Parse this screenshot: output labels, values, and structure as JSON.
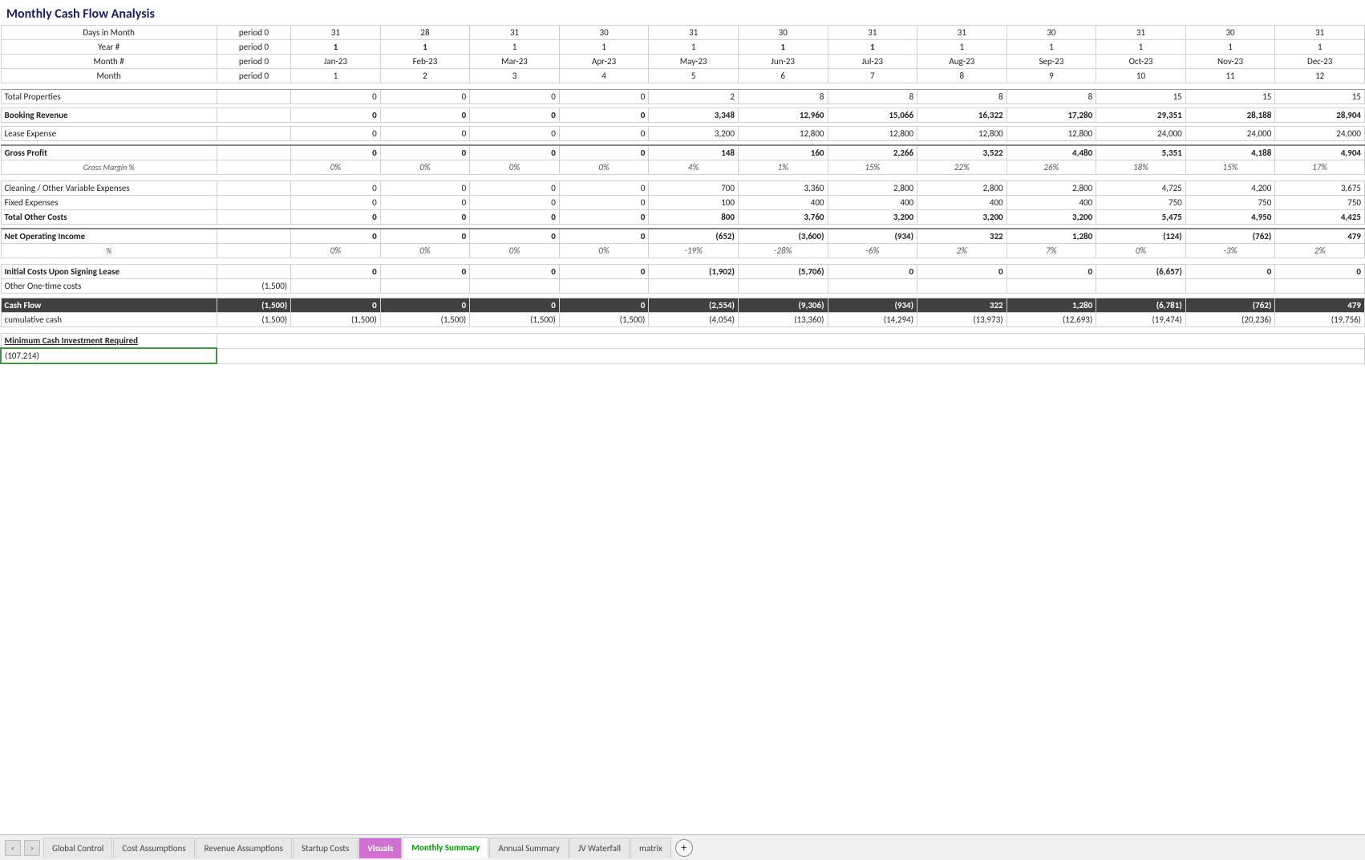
{
  "title": "Monthly Cash Flow Analysis",
  "header": {
    "rows": {
      "days_label": "Days in Month",
      "days_period": "period 0",
      "year_label": "Year #",
      "year_period": "period 0",
      "month_num_label": "Month #",
      "month_num_period": "period 0",
      "month_label": "Month",
      "month_period": "period 0"
    },
    "months": [
      {
        "days": 31,
        "year": 1,
        "month_num": 1,
        "month": "Jan-23"
      },
      {
        "days": 28,
        "year": 1,
        "month_num": 2,
        "month": "Feb-23"
      },
      {
        "days": 31,
        "year": 1,
        "month_num": 3,
        "month": "Mar-23"
      },
      {
        "days": 30,
        "year": 1,
        "month_num": 4,
        "month": "Apr-23"
      },
      {
        "days": 31,
        "year": 1,
        "month_num": 5,
        "month": "May-23"
      },
      {
        "days": 30,
        "year": 1,
        "month_num": 6,
        "month": "Jun-23"
      },
      {
        "days": 31,
        "year": 1,
        "month_num": 7,
        "month": "Jul-23"
      },
      {
        "days": 31,
        "year": 1,
        "month_num": 8,
        "month": "Aug-23"
      },
      {
        "days": 30,
        "year": 1,
        "month_num": 9,
        "month": "Sep-23"
      },
      {
        "days": 31,
        "year": 1,
        "month_num": 10,
        "month": "Oct-23"
      },
      {
        "days": 30,
        "year": 1,
        "month_num": 11,
        "month": "Nov-23"
      },
      {
        "days": 31,
        "year": 1,
        "month_num": 12,
        "month": "Dec-23"
      }
    ]
  },
  "rows": {
    "total_properties_label": "Total Properties",
    "total_properties": [
      0,
      0,
      0,
      0,
      2,
      8,
      8,
      8,
      8,
      15,
      15,
      15
    ],
    "booking_revenue_label": "Booking Revenue",
    "booking_revenue": [
      0,
      0,
      0,
      0,
      3348,
      12960,
      15066,
      16322,
      17280,
      29351,
      28188,
      28904
    ],
    "lease_expense_label": "Lease Expense",
    "lease_expense": [
      0,
      0,
      0,
      0,
      3200,
      12800,
      12800,
      12800,
      12800,
      24000,
      24000,
      24000
    ],
    "gross_profit_label": "Gross Profit",
    "gross_profit": [
      0,
      0,
      0,
      0,
      148,
      160,
      2266,
      3522,
      4480,
      5351,
      4188,
      4904
    ],
    "gross_margin_label": "Gross Margin %",
    "gross_margin": [
      "0%",
      "0%",
      "0%",
      "0%",
      "4%",
      "1%",
      "15%",
      "22%",
      "26%",
      "18%",
      "15%",
      "17%"
    ],
    "cleaning_label": "Cleaning / Other Variable Expenses",
    "cleaning": [
      0,
      0,
      0,
      0,
      700,
      3360,
      2800,
      2800,
      2800,
      4725,
      4200,
      3675
    ],
    "fixed_label": "Fixed Expenses",
    "fixed": [
      0,
      0,
      0,
      0,
      100,
      400,
      400,
      400,
      400,
      750,
      750,
      750
    ],
    "total_other_label": "Total Other Costs",
    "total_other": [
      0,
      0,
      0,
      0,
      800,
      3760,
      3200,
      3200,
      3200,
      5475,
      4950,
      4425
    ],
    "net_op_label": "Net Operating Income",
    "net_op": [
      "0",
      "0",
      "0",
      "0",
      "(652)",
      "(3,600)",
      "(934)",
      "322",
      "1,280",
      "(124)",
      "(762)",
      "479"
    ],
    "net_op_pct": [
      "0%",
      "0%",
      "0%",
      "0%",
      "-19%",
      "-28%",
      "-6%",
      "2%",
      "7%",
      "0%",
      "-3%",
      "2%"
    ],
    "initial_costs_label": "Initial Costs Upon Signing Lease",
    "initial_costs": [
      "0",
      "0",
      "0",
      "0",
      "(1,902)",
      "(5,706)",
      "0",
      "0",
      "0",
      "(6,657)",
      "0",
      "0"
    ],
    "other_onetime_label": "Other One-time costs",
    "other_onetime_value": "(1,500)",
    "cash_flow_label": "Cash Flow",
    "cash_flow_period_col": "(1,500)",
    "cash_flow": [
      "0",
      "0",
      "0",
      "0",
      "(2,554)",
      "(9,306)",
      "(934)",
      "322",
      "1,280",
      "(6,781)",
      "(762)",
      "479"
    ],
    "cumulative_label": "cumulative cash",
    "cumulative_period": "(1,500)",
    "cumulative": [
      "(1,500)",
      "(1,500)",
      "(1,500)",
      "(1,500)",
      "(4,054)",
      "(13,360)",
      "(14,294)",
      "(13,973)",
      "(12,693)",
      "(19,474)",
      "(20,236)",
      "(19,756)"
    ],
    "min_cash_label": "Minimum Cash Investment Required",
    "min_cash_value": "(107,214)"
  },
  "tabs": [
    {
      "label": "Global Control",
      "active": false
    },
    {
      "label": "Cost Assumptions",
      "active": false
    },
    {
      "label": "Revenue Assumptions",
      "active": false
    },
    {
      "label": "Startup Costs",
      "active": false
    },
    {
      "label": "Visuals",
      "active": false
    },
    {
      "label": "Monthly Summary",
      "active": true
    },
    {
      "label": "Annual Summary",
      "active": false
    },
    {
      "label": "JV Waterfall",
      "active": false
    },
    {
      "label": "matrix",
      "active": false
    }
  ]
}
